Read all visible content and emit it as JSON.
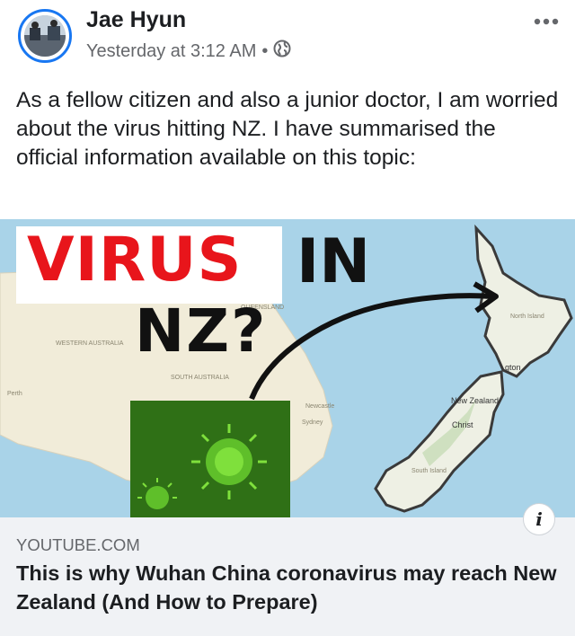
{
  "post": {
    "author": "Jae Hyun",
    "timestamp": "Yesterday at 3:12 AM",
    "separator": "•",
    "audience_icon": "globe-icon",
    "more_icon": "more-options-icon",
    "text": "As a fellow citizen and also a junior doctor, I am worried about the virus hitting NZ. I have summarised the official information available on this topic:"
  },
  "link_preview": {
    "thumbnail": {
      "headline_word_1": "VIRUS",
      "headline_word_2": "IN",
      "headline_word_3": "NZ?",
      "map_labels": {
        "western_australia": "WESTERN AUSTRALIA",
        "south_australia": "SOUTH AUSTRALIA",
        "queensland": "QUEENSLAND",
        "perth": "Perth",
        "newcastle": "Newcastle",
        "sydney": "Sydney",
        "new_zealand": "New Zealand",
        "christchurch": "Christ",
        "wellington": "gton",
        "north_island": "North Island",
        "south_island": "South Island"
      }
    },
    "info_icon_label": "i",
    "domain": "YOUTUBE.COM",
    "title": "This is why Wuhan China coronavirus may reach New Zealand (And How to Prepare)"
  },
  "colors": {
    "accent": "#1877f2",
    "virus_red": "#e8151b",
    "ocean": "#a9d3e8",
    "land": "#f1ecd9",
    "virus_green": "#5fbf2a",
    "caption_bg": "#f0f2f5"
  }
}
